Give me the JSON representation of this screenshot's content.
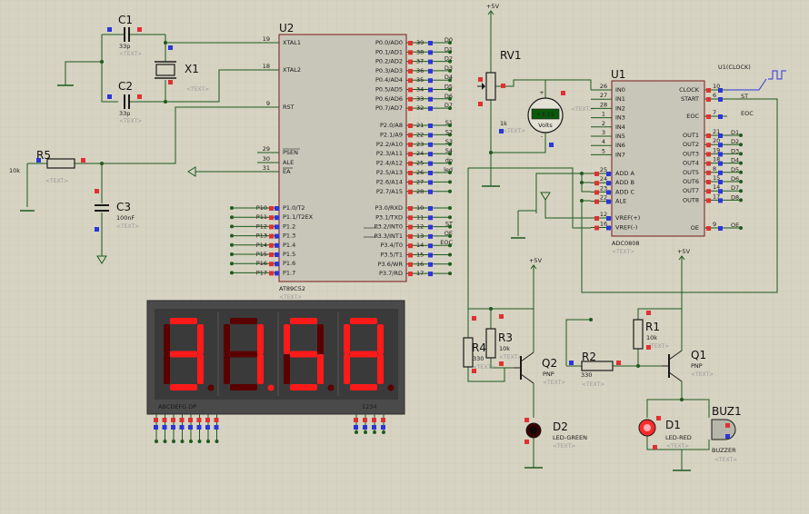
{
  "colors": {
    "background": "#d6d3c2",
    "grid": "#c9c6b5",
    "wire": "#1e5a1e",
    "chip": "#c8c6b9",
    "chip_border": "#7a1a1a",
    "pin_red": "#e03030",
    "pin_blue": "#2b36d9",
    "segment_on": "#ff1a1a",
    "segment_off": "#5a0000",
    "display_bg": "#3a3a3a"
  },
  "text_placeholder": "<TEXT>",
  "components": {
    "u2": {
      "ref": "U2",
      "type": "AT89C52",
      "left_pins": [
        {
          "n": "19",
          "name": "XTAL1"
        },
        {
          "n": "18",
          "name": "XTAL2"
        },
        {
          "n": "9",
          "name": "RST"
        },
        {
          "n": "29",
          "name": "PSEN"
        },
        {
          "n": "30",
          "name": "ALE"
        },
        {
          "n": "31",
          "name": "EA"
        }
      ],
      "p1_pins": [
        {
          "n": "1",
          "name": "P1.0/T2"
        },
        {
          "n": "2",
          "name": "P1.1/T2EX"
        },
        {
          "n": "3",
          "name": "P1.2"
        },
        {
          "n": "4",
          "name": "P1.3"
        },
        {
          "n": "5",
          "name": "P1.4"
        },
        {
          "n": "6",
          "name": "P1.5"
        },
        {
          "n": "7",
          "name": "P1.6"
        },
        {
          "n": "8",
          "name": "P1.7"
        }
      ],
      "p1_labels": [
        "P10",
        "P11",
        "P12",
        "P13",
        "P14",
        "P15",
        "P16",
        "P17"
      ],
      "p0_pins": [
        {
          "n": "39",
          "name": "P0.0/AD0",
          "net": "D0"
        },
        {
          "n": "38",
          "name": "P0.1/AD1",
          "net": "D1"
        },
        {
          "n": "37",
          "name": "P0.2/AD2",
          "net": "D2"
        },
        {
          "n": "36",
          "name": "P0.3/AD3",
          "net": "D3"
        },
        {
          "n": "35",
          "name": "P0.4/AD4",
          "net": "D4"
        },
        {
          "n": "34",
          "name": "P0.5/AD5",
          "net": "D5"
        },
        {
          "n": "33",
          "name": "P0.6/AD6",
          "net": "D6"
        },
        {
          "n": "32",
          "name": "P0.7/AD7",
          "net": "D7"
        }
      ],
      "p2_pins": [
        {
          "n": "21",
          "name": "P2.0/A8",
          "net": "S1"
        },
        {
          "n": "22",
          "name": "P2.1/A9",
          "net": "S2"
        },
        {
          "n": "23",
          "name": "P2.2/A10",
          "net": "S3"
        },
        {
          "n": "24",
          "name": "P2.3/A11",
          "net": "S4"
        },
        {
          "n": "25",
          "name": "P2.4/A12",
          "net": "dp"
        },
        {
          "n": "26",
          "name": "P2.5/A13",
          "net": "led"
        },
        {
          "n": "27",
          "name": "P2.6/A14",
          "net": ""
        },
        {
          "n": "28",
          "name": "P2.7/A15",
          "net": ""
        }
      ],
      "p3_pins": [
        {
          "n": "10",
          "name": "P3.0/RXD",
          "net": ""
        },
        {
          "n": "11",
          "name": "P3.1/TXD",
          "net": ""
        },
        {
          "n": "12",
          "name": "P3.2/INT0",
          "net": "ST"
        },
        {
          "n": "13",
          "name": "P3.3/INT1",
          "net": "OE"
        },
        {
          "n": "14",
          "name": "P3.4/T0",
          "net": "EOC"
        },
        {
          "n": "15",
          "name": "P3.5/T1",
          "net": ""
        },
        {
          "n": "16",
          "name": "P3.6/WR",
          "net": ""
        },
        {
          "n": "17",
          "name": "P3.7/RD",
          "net": ""
        }
      ]
    },
    "u1": {
      "ref": "U1",
      "type": "ADC0808",
      "in_pins": [
        {
          "n": "26",
          "name": "IN0"
        },
        {
          "n": "27",
          "name": "IN1"
        },
        {
          "n": "28",
          "name": "IN2"
        },
        {
          "n": "1",
          "name": "IN3"
        },
        {
          "n": "2",
          "name": "IN4"
        },
        {
          "n": "3",
          "name": "IN5"
        },
        {
          "n": "4",
          "name": "IN6"
        },
        {
          "n": "5",
          "name": "IN7"
        }
      ],
      "addr_pins": [
        {
          "n": "25",
          "name": "ADD A"
        },
        {
          "n": "24",
          "name": "ADD B"
        },
        {
          "n": "23",
          "name": "ADD C"
        },
        {
          "n": "22",
          "name": "ALE"
        }
      ],
      "ref_pins": [
        {
          "n": "12",
          "name": "VREF(+)"
        },
        {
          "n": "16",
          "name": "VREF(-)"
        }
      ],
      "right_pins": [
        {
          "n": "10",
          "name": "CLOCK",
          "net": ""
        },
        {
          "n": "6",
          "name": "START",
          "net": "ST"
        },
        {
          "n": "7",
          "name": "EOC",
          "net": "EOC"
        }
      ],
      "out_pins": [
        {
          "n": "21",
          "name": "OUT1",
          "net": "D1"
        },
        {
          "n": "20",
          "name": "OUT2",
          "net": "D2"
        },
        {
          "n": "19",
          "name": "OUT3",
          "net": "D3"
        },
        {
          "n": "18",
          "name": "OUT4",
          "net": "D4"
        },
        {
          "n": "8",
          "name": "OUT5",
          "net": "D5"
        },
        {
          "n": "15",
          "name": "OUT6",
          "net": "D6"
        },
        {
          "n": "14",
          "name": "OUT7",
          "net": "D7"
        },
        {
          "n": "17",
          "name": "OUT8",
          "net": "D8"
        }
      ],
      "oe_pin": {
        "n": "9",
        "name": "OE",
        "net": "OE"
      }
    },
    "c1": {
      "ref": "C1",
      "value": "33p"
    },
    "c2": {
      "ref": "C2",
      "value": "33p"
    },
    "x1": {
      "ref": "X1"
    },
    "r5": {
      "ref": "R5",
      "value": "10k"
    },
    "c3": {
      "ref": "C3",
      "value": "100nF"
    },
    "rv1": {
      "ref": "RV1",
      "value": "1k"
    },
    "voltmeter": {
      "reading": "+3.15",
      "unit": "Volts"
    },
    "clock": {
      "label": "U1(CLOCK)"
    },
    "r4": {
      "ref": "R4",
      "value": "330"
    },
    "r3": {
      "ref": "R3",
      "value": "10k"
    },
    "q2": {
      "ref": "Q2",
      "type": "PNP"
    },
    "d2": {
      "ref": "D2",
      "type": "LED-GREEN"
    },
    "r2": {
      "ref": "R2",
      "value": "330"
    },
    "r1": {
      "ref": "R1",
      "value": "10k"
    },
    "q1": {
      "ref": "Q1",
      "type": "PNP"
    },
    "d1": {
      "ref": "D1",
      "type": "LED-RED"
    },
    "buz1": {
      "ref": "BUZ1",
      "type": "BUZZER"
    },
    "display": {
      "digits": [
        "3",
        "1",
        "5",
        "8"
      ],
      "dp_on": [
        false,
        true,
        false,
        false
      ],
      "segment_label": "ABCDEFG  DP",
      "digit_label": "1234"
    }
  },
  "power": {
    "vcc": "+5V"
  }
}
